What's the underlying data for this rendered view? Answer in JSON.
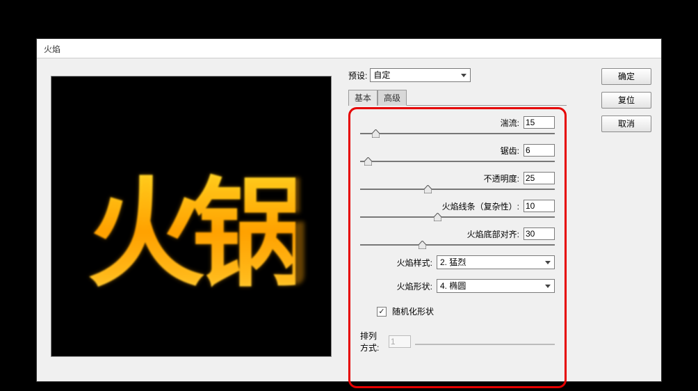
{
  "dialog_title": "火焰",
  "preset": {
    "label": "预设:",
    "value": "自定"
  },
  "tabs": {
    "basic": "基本",
    "advanced": "高级"
  },
  "sliders": {
    "turbulence": {
      "label": "湍流:",
      "value": "15",
      "pos": 6
    },
    "jag": {
      "label": "锯齿:",
      "value": "6",
      "pos": 2
    },
    "opacity": {
      "label": "不透明度:",
      "value": "25",
      "pos": 33
    },
    "complexity": {
      "label": "火焰线条（复杂性）:",
      "value": "10",
      "pos": 38
    },
    "bottom_align": {
      "label": "火焰底部对齐:",
      "value": "30",
      "pos": 30
    }
  },
  "combos": {
    "style": {
      "label": "火焰样式:",
      "value": "2. 猛烈"
    },
    "shape": {
      "label": "火焰形状:",
      "value": "4. 椭圆"
    }
  },
  "randomize": {
    "label": "随机化形状",
    "checked": true
  },
  "arrangement": {
    "label": "排列方式:",
    "value": "1"
  },
  "buttons": {
    "ok": "确定",
    "reset": "复位",
    "cancel": "取消"
  },
  "preview_text": "火锅"
}
